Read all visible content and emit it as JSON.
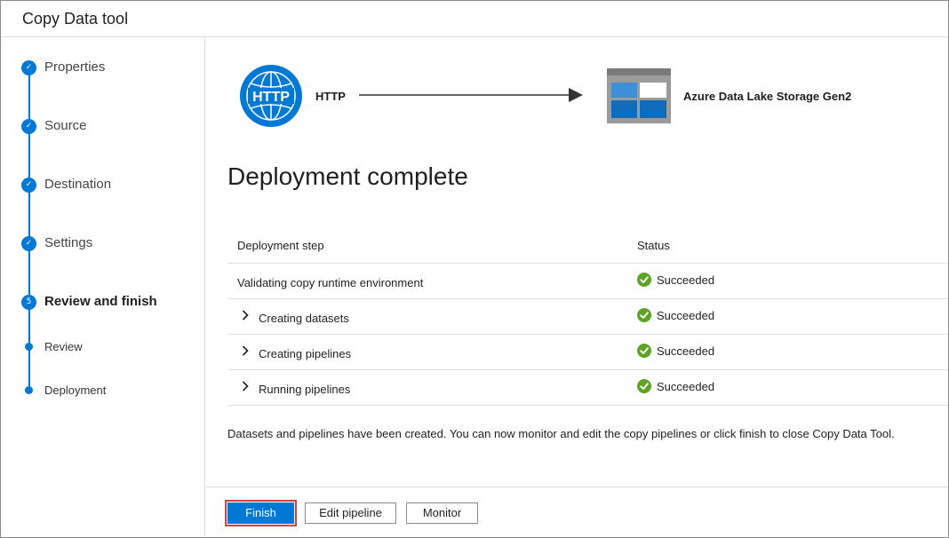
{
  "window": {
    "title": "Copy Data tool"
  },
  "steps": [
    {
      "label": "Properties",
      "marker": "✓"
    },
    {
      "label": "Source",
      "marker": "✓"
    },
    {
      "label": "Destination",
      "marker": "✓"
    },
    {
      "label": "Settings",
      "marker": "✓"
    },
    {
      "label": "Review and finish",
      "marker": "5"
    }
  ],
  "substeps": [
    {
      "label": "Review"
    },
    {
      "label": "Deployment"
    }
  ],
  "flow": {
    "source_icon_text": "HTTP",
    "source_label": "HTTP",
    "destination_label": "Azure Data Lake Storage Gen2"
  },
  "heading": "Deployment complete",
  "table": {
    "headers": {
      "step": "Deployment step",
      "status": "Status"
    },
    "rows": [
      {
        "step": "Validating copy runtime environment",
        "status": "Succeeded"
      },
      {
        "step": "Creating datasets",
        "status": "Succeeded"
      },
      {
        "step": "Creating pipelines",
        "status": "Succeeded"
      },
      {
        "step": "Running pipelines",
        "status": "Succeeded"
      }
    ]
  },
  "note": "Datasets and pipelines have been created. You can now monitor and edit the copy pipelines or click finish to close Copy Data Tool.",
  "buttons": {
    "finish": "Finish",
    "edit_pipeline": "Edit pipeline",
    "monitor": "Monitor"
  },
  "colors": {
    "accent": "#0078d4",
    "success": "#5ea326",
    "highlight": "#e03b3b"
  }
}
